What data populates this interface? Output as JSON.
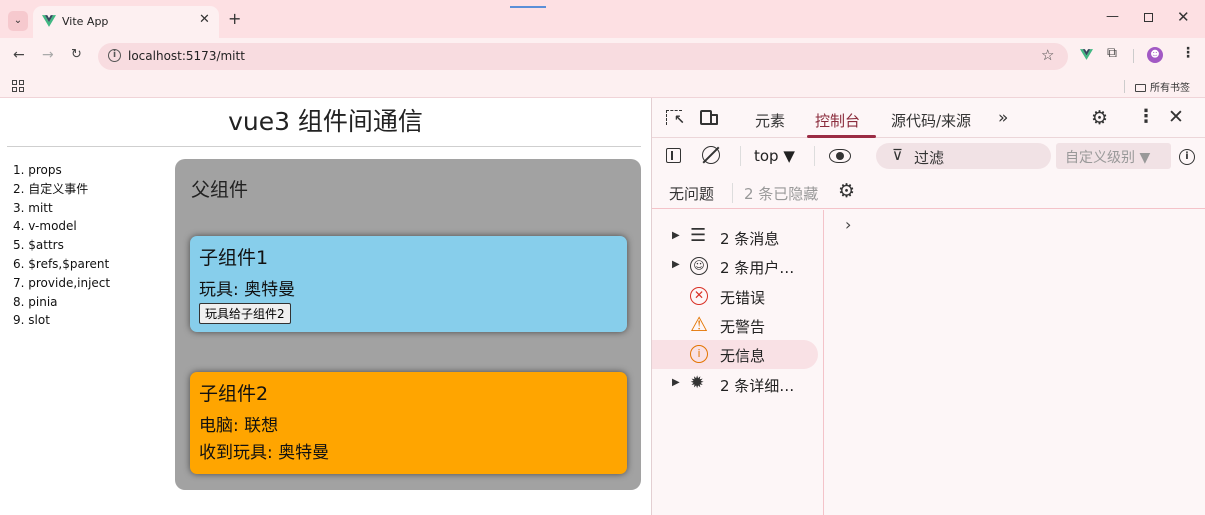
{
  "browser": {
    "tab_title": "Vite App",
    "new_tab_symbol": "+",
    "url": "localhost:5173/mitt",
    "all_bookmarks_label": "所有书签"
  },
  "page": {
    "title": "vue3 组件间通信",
    "nav_items": [
      "1. props",
      "2. 自定义事件",
      "3. mitt",
      "4. v-model",
      "5. $attrs",
      "6. $refs,$parent",
      "7. provide,inject",
      "8. pinia",
      "9. slot"
    ],
    "parent": {
      "title": "父组件"
    },
    "child1": {
      "title": "子组件1",
      "toy_line": "玩具: 奥特曼",
      "button_label": "玩具给子组件2"
    },
    "child2": {
      "title": "子组件2",
      "computer_line": "电脑: 联想",
      "received_toy_line": "收到玩具: 奥特曼"
    }
  },
  "devtools": {
    "tabs": [
      "元素",
      "控制台",
      "源代码/来源"
    ],
    "more_tabs": "»",
    "context": "top ▼",
    "filter_placeholder": "过滤",
    "log_level": "自定义级别 ▼",
    "no_issues": "无问题",
    "hidden_count": "2 条已隐藏",
    "sidebar": [
      {
        "label": "2 条消息",
        "icon": "list-icon",
        "expandable": true,
        "selected": false
      },
      {
        "label": "2 条用户…",
        "icon": "user-icon",
        "expandable": true,
        "selected": false
      },
      {
        "label": "无错误",
        "icon": "error-icon",
        "expandable": false,
        "selected": false
      },
      {
        "label": "无警告",
        "icon": "warning-icon",
        "expandable": false,
        "selected": false
      },
      {
        "label": "无信息",
        "icon": "info-icon",
        "expandable": false,
        "selected": true
      },
      {
        "label": "2 条详细…",
        "icon": "bug-icon",
        "expandable": true,
        "selected": false
      }
    ],
    "prompt": "›"
  },
  "colors": {
    "tabstrip_bg": "#fde0e3",
    "parent_bg": "#a2a2a2",
    "child1_bg": "#87ceeb",
    "child2_bg": "#ffa500",
    "console_tab_accent": "#9b2c44",
    "error_red": "#d93025",
    "warning_orange": "#e37400"
  }
}
